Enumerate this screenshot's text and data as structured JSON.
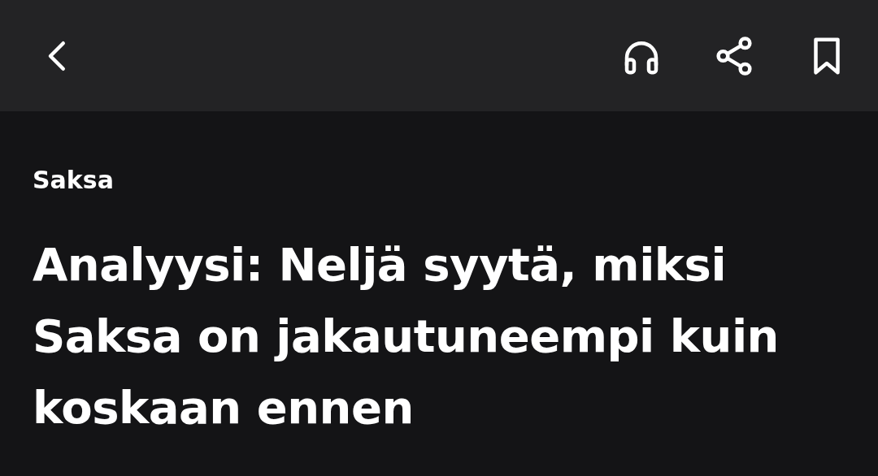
{
  "toolbar": {
    "buttons": [
      {
        "kind": "back"
      },
      {
        "kind": "listen"
      },
      {
        "kind": "share"
      },
      {
        "kind": "bookmark",
        "selected": false
      }
    ]
  },
  "article": {
    "category": "Saksa",
    "headline": "Analyysi: Neljä syytä, miksi Saksa on jakautuneempi kuin koskaan ennen"
  }
}
